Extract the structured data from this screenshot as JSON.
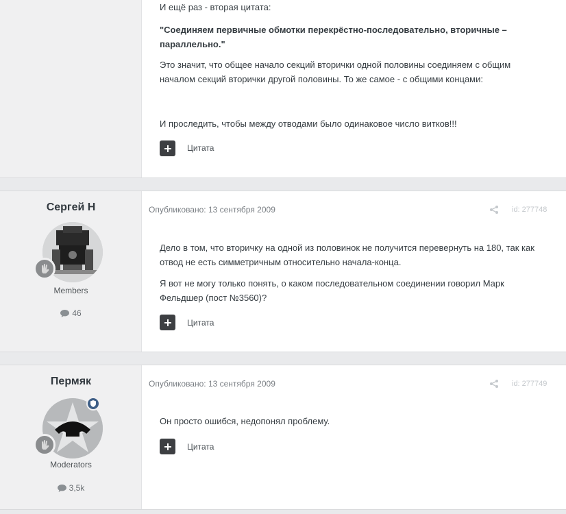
{
  "posts": [
    {
      "paragraphs": [
        "И ещё раз - вторая цитата:",
        "\"Соединяем первичные обмотки перекрёстно-последовательно, вторичные – параллельно.\"",
        "Это значит, что общее начало секций вторички одной половины соединяем с общим началом секций вторички другой половины. То же самое - с общими концами:",
        "И проследить, чтобы между отводами было одинаковое число витков!!!"
      ],
      "quote_label": "Цитата"
    },
    {
      "author": "Сергей Н",
      "group": "Members",
      "post_count": "46",
      "published": "Опубликовано: 13 сентября 2009",
      "post_id": "id: 277748",
      "paragraphs": [
        "Дело в том, что вторичку на одной из половинок не получится перевернуть на 180, так как отвод не есть симметричным относительно начала-конца.",
        "Я вот не могу только понять, о каком последовательном соединении говорил Марк Фельдшер (пост №3560)?"
      ],
      "quote_label": "Цитата"
    },
    {
      "author": "Пермяк",
      "group": "Moderators",
      "post_count": "3,5k",
      "published": "Опубликовано: 13 сентября 2009",
      "post_id": "id: 277749",
      "paragraphs": [
        "Он просто ошибся, недопонял проблему."
      ],
      "quote_label": "Цитата"
    }
  ],
  "icons": {
    "quote": "plus-icon",
    "share": "share-icon",
    "comments": "comment-icon",
    "rank": "hand-wave-icon",
    "moderator": "shield-icon"
  },
  "colors": {
    "page_bg": "#e9eaec",
    "author_bg": "#f0f0f1",
    "moderator_badge": "#3e5e86",
    "quote_button": "#3d3f42"
  }
}
